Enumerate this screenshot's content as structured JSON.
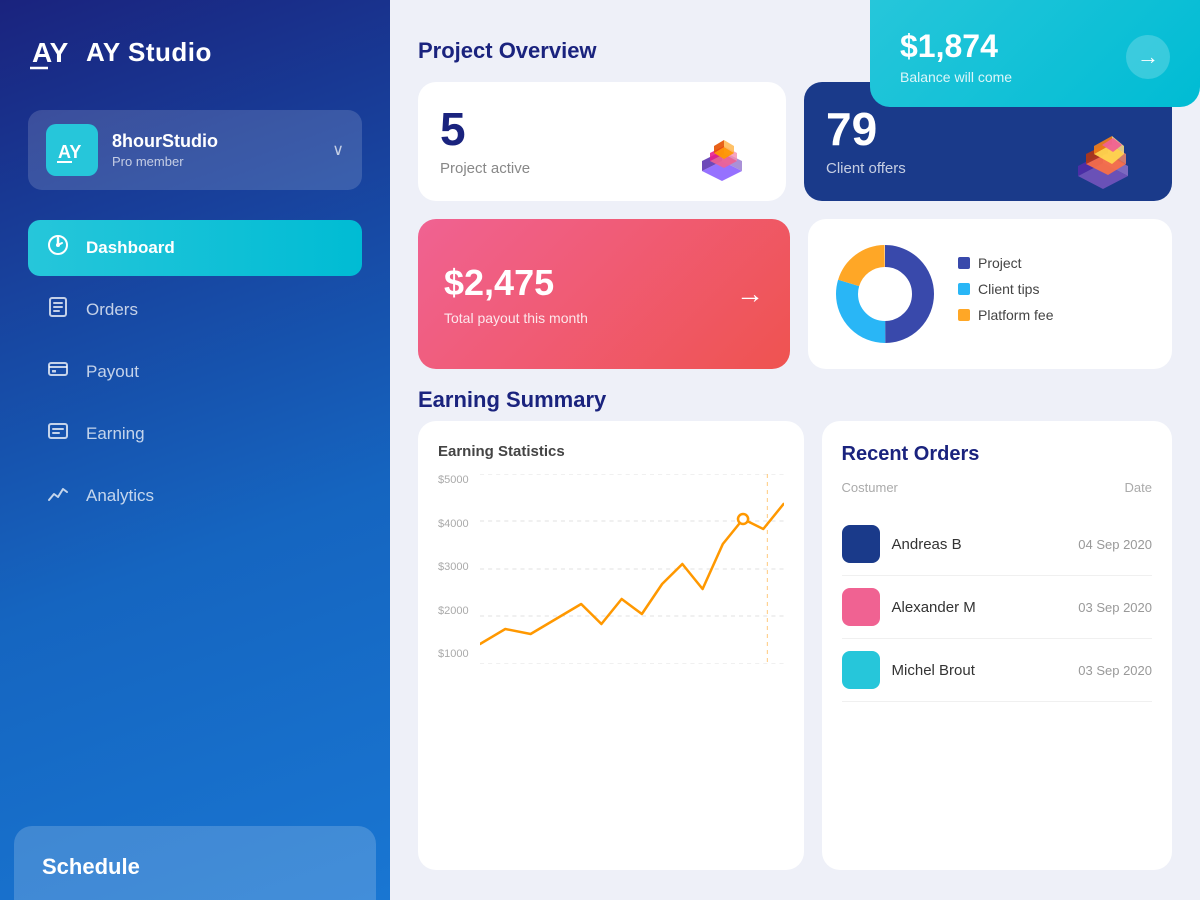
{
  "sidebar": {
    "logo": "AY Studio",
    "logo_symbol": "AY",
    "user": {
      "name": "8hourStudio",
      "role": "Pro member",
      "avatar_text": "AY"
    },
    "nav": [
      {
        "id": "dashboard",
        "label": "Dashboard",
        "icon": "⬤",
        "active": true
      },
      {
        "id": "orders",
        "label": "Orders",
        "icon": "📋"
      },
      {
        "id": "payout",
        "label": "Payout",
        "icon": "💳"
      },
      {
        "id": "earning",
        "label": "Earning",
        "icon": "🗂"
      },
      {
        "id": "analytics",
        "label": "Analytics",
        "icon": "📈"
      }
    ],
    "schedule_label": "Schedule"
  },
  "balance_card": {
    "amount": "$1,874",
    "label": "Balance will come",
    "arrow": "→"
  },
  "overview": {
    "title": "Project Overview",
    "project_count": "5",
    "project_label": "Project active",
    "offers_count": "79",
    "offers_label": "Client offers"
  },
  "payout": {
    "amount": "$2,475",
    "label": "Total payout this month",
    "arrow": "→"
  },
  "donut": {
    "legend": [
      {
        "label": "Project",
        "color": "#3949ab"
      },
      {
        "label": "Client tips",
        "color": "#29b6f6"
      },
      {
        "label": "Platform fee",
        "color": "#ffa726"
      }
    ]
  },
  "earning": {
    "section_title": "Earning Summary",
    "chart_title": "Earning Statistics",
    "y_labels": [
      "$5000",
      "$4000",
      "$3000",
      "$2000",
      "$1000"
    ]
  },
  "recent_orders": {
    "title": "Recent Orders",
    "col_customer": "Costumer",
    "col_date": "Date",
    "orders": [
      {
        "name": "Andreas B",
        "date": "04 Sep 2020",
        "color": "#1a3a8a"
      },
      {
        "name": "Alexander M",
        "date": "03 Sep 2020",
        "color": "#f06292"
      },
      {
        "name": "Michel Brout",
        "date": "03 Sep 2020",
        "color": "#26c6da"
      }
    ]
  }
}
